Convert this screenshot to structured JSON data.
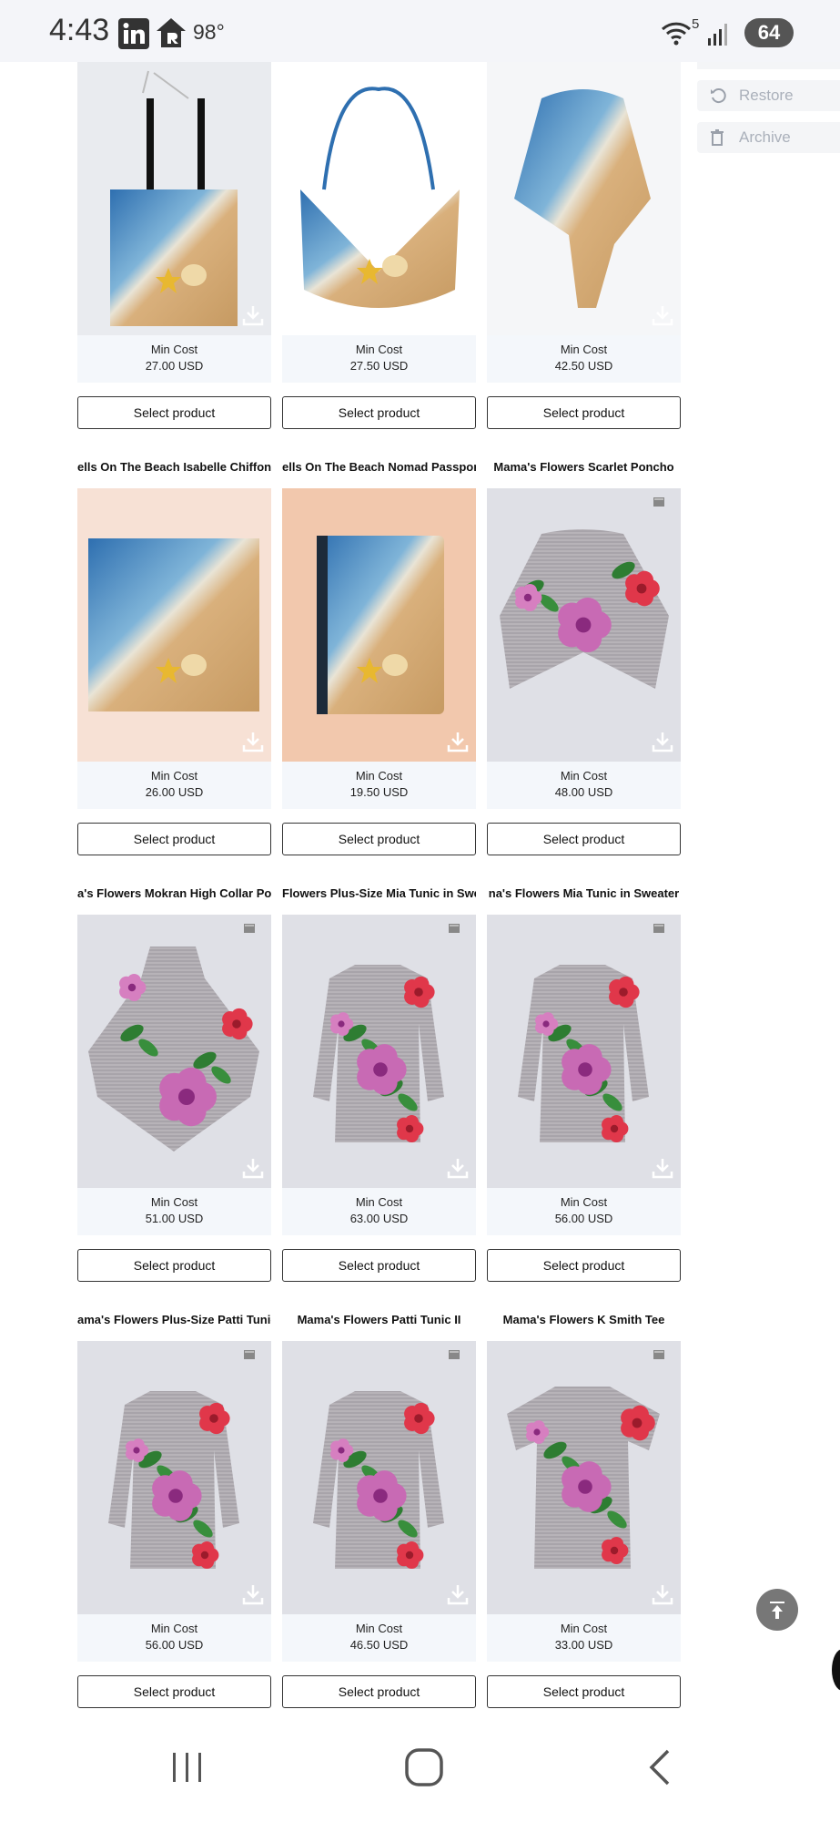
{
  "status_bar": {
    "time": "4:43",
    "temperature": "98°",
    "wifi_badge": "5",
    "battery": "64"
  },
  "side_actions": {
    "restore_label": "Restore",
    "archive_label": "Archive"
  },
  "product_grid": {
    "rows": [
      [
        {
          "title": "",
          "image": "tote-bag-beach",
          "min_cost_label": "Min Cost",
          "price": "27.00 USD",
          "button_label": "Select product"
        },
        {
          "title": "",
          "image": "hobo-bag-beach",
          "min_cost_label": "Min Cost",
          "price": "27.50 USD",
          "button_label": "Select product"
        },
        {
          "title": "",
          "image": "wrap-beach",
          "min_cost_label": "Min Cost",
          "price": "42.50 USD",
          "button_label": "Select product"
        }
      ],
      [
        {
          "title": "ells On The Beach Isabelle Chiffon S",
          "image": "scarf-beach",
          "min_cost_label": "Min Cost",
          "price": "26.00 USD",
          "button_label": "Select product"
        },
        {
          "title": "ells On The Beach Nomad Passport",
          "image": "passport-beach",
          "min_cost_label": "Min Cost",
          "price": "19.50 USD",
          "button_label": "Select product"
        },
        {
          "title": "Mama's Flowers Scarlet Poncho",
          "image": "poncho-flowers",
          "min_cost_label": "Min Cost",
          "price": "48.00 USD",
          "button_label": "Select product"
        }
      ],
      [
        {
          "title": "a's Flowers Mokran High Collar Po",
          "image": "collar-poncho-flowers",
          "min_cost_label": "Min Cost",
          "price": "51.00 USD",
          "button_label": "Select product"
        },
        {
          "title": "Flowers Plus-Size Mia Tunic in Swe",
          "image": "tunic-flowers",
          "min_cost_label": "Min Cost",
          "price": "63.00 USD",
          "button_label": "Select product"
        },
        {
          "title": "na's Flowers Mia Tunic in Sweater",
          "image": "tunic-flowers",
          "min_cost_label": "Min Cost",
          "price": "56.00 USD",
          "button_label": "Select product"
        }
      ],
      [
        {
          "title": "ama's Flowers Plus-Size Patti Tunic",
          "image": "tunic-flowers",
          "min_cost_label": "Min Cost",
          "price": "56.00 USD",
          "button_label": "Select product"
        },
        {
          "title": "Mama's Flowers Patti Tunic II",
          "image": "tunic-flowers",
          "min_cost_label": "Min Cost",
          "price": "46.50 USD",
          "button_label": "Select product"
        },
        {
          "title": "Mama's Flowers K Smith Tee",
          "image": "tee-flowers",
          "min_cost_label": "Min Cost",
          "price": "33.00 USD",
          "button_label": "Select product"
        }
      ]
    ]
  },
  "icons": {
    "scroll_top": "arrow-up-to-line-icon",
    "nav_recents": "recent-apps-icon",
    "nav_home": "home-icon",
    "nav_back": "back-icon"
  },
  "colors": {
    "button_border": "#333333",
    "cost_box_bg": "#f4f7fb",
    "scroll_top_bg": "#777777"
  }
}
